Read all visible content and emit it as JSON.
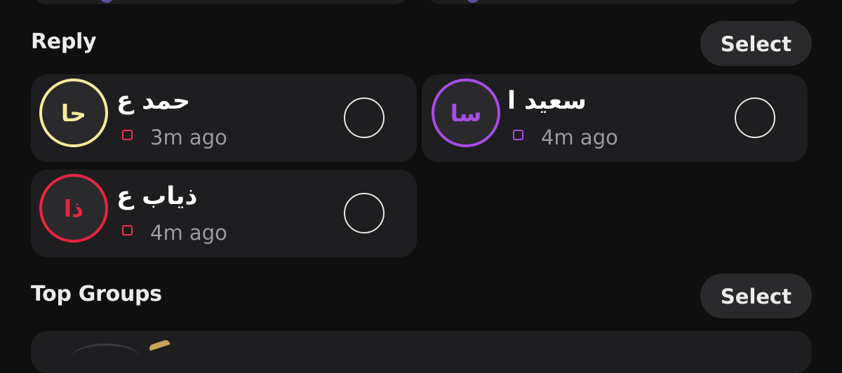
{
  "reply": {
    "title": "Reply",
    "select_label": "Select",
    "items": [
      {
        "name": "حمد ع",
        "initials": "حا",
        "time": "3m ago",
        "avatar_color": "#f7ec9e",
        "status_color": "#e8334a"
      },
      {
        "name": "سعيد ا",
        "initials": "سا",
        "time": "4m ago",
        "avatar_color": "#a64de6",
        "status_color": "#a64de6"
      },
      {
        "name": "ذياب ع",
        "initials": "ذا",
        "time": "4m ago",
        "avatar_color": "#e8253f",
        "status_color": "#e8334a"
      }
    ]
  },
  "top_groups": {
    "title": "Top Groups",
    "select_label": "Select"
  }
}
